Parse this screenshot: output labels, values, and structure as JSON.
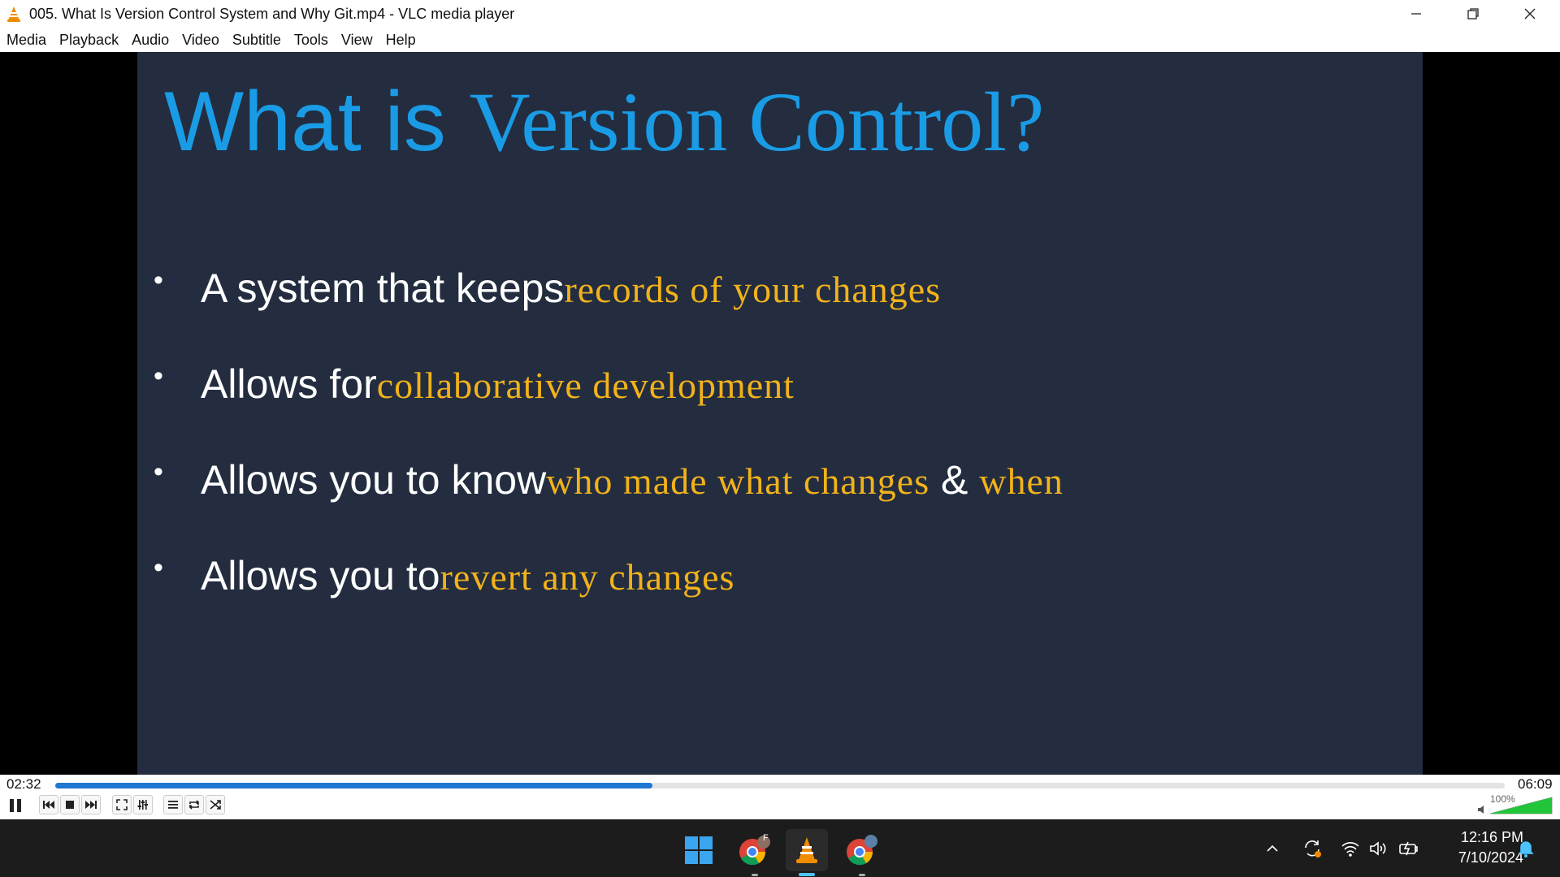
{
  "window": {
    "title": "005. What Is Version Control System and Why Git.mp4 - VLC media player"
  },
  "menu": [
    "Media",
    "Playback",
    "Audio",
    "Video",
    "Subtitle",
    "Tools",
    "View",
    "Help"
  ],
  "slide": {
    "title_part1": "What is ",
    "title_part2": "Version Control?",
    "bullets": [
      {
        "plain": "A system that keeps ",
        "highlight": "records of  your changes"
      },
      {
        "plain": "Allows for ",
        "highlight": "collaborative development"
      },
      {
        "plain": "Allows you to know ",
        "highlight": "who made what changes",
        "amp": " & ",
        "highlight2": "when"
      },
      {
        "plain": "Allows you to ",
        "highlight": "revert any changes"
      }
    ]
  },
  "player": {
    "elapsed": "02:32",
    "duration": "06:09",
    "progress_fraction": 0.412,
    "volume_label": "100%",
    "volume_fraction": 1.0
  },
  "taskbar": {
    "time": "12:16 PM",
    "date": "7/10/2024",
    "chrome_profile_initial": "F"
  },
  "colors": {
    "slide_bg": "#232d3f",
    "title_blue": "#1a9be6",
    "highlight_gold": "#f2b21b",
    "seek_blue": "#1f78d1",
    "vlc_orange": "#f28c00"
  }
}
